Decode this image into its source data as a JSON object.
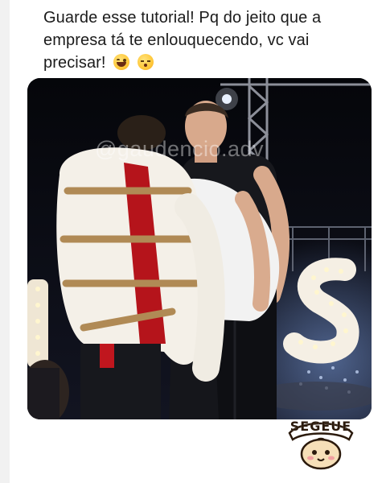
{
  "post": {
    "caption": "Guarde esse tutorial! Pq do jeito que a empresa tá te enlouquecendo, vc vai precisar!",
    "caption_emojis": [
      "laughing-face",
      "sleepy-face"
    ]
  },
  "video": {
    "watermark": "@gaudencio.adv",
    "sign_letter": "S"
  },
  "sticker": {
    "text": "SEGEUE",
    "icon": "cute-bun-mascot"
  }
}
